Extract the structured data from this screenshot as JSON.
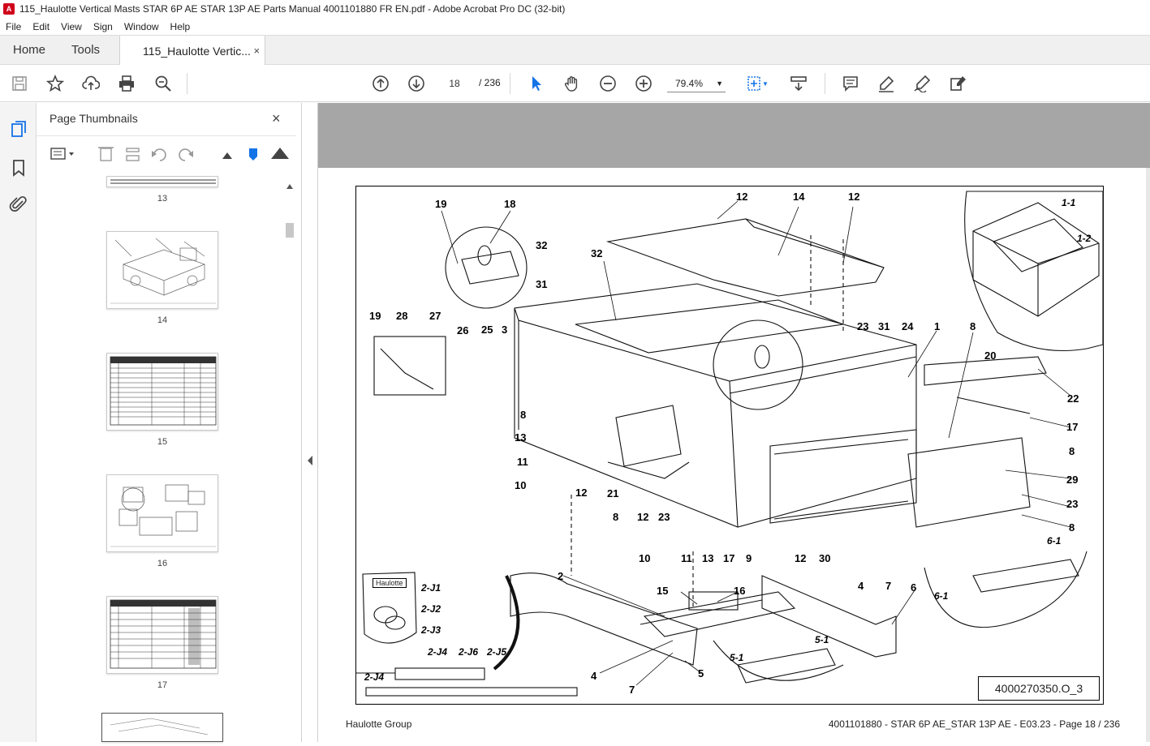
{
  "window": {
    "title": "115_Haulotte Vertical Masts STAR 6P AE STAR 13P AE Parts Manual 4001101880 FR EN.pdf - Adobe Acrobat Pro DC (32-bit)"
  },
  "menu": [
    "File",
    "Edit",
    "View",
    "Sign",
    "Window",
    "Help"
  ],
  "tabs": {
    "home": "Home",
    "tools": "Tools",
    "document": "115_Haulotte Vertic...",
    "close": "×"
  },
  "toolbar": {
    "page_current": "18",
    "page_total": "/ 236",
    "zoom": "79.4%"
  },
  "thumbnails": {
    "title": "Page Thumbnails",
    "close": "×",
    "pages": [
      "13",
      "14",
      "15",
      "16",
      "17"
    ]
  },
  "drawing": {
    "callouts": [
      "19",
      "18",
      "12",
      "14",
      "12",
      "32",
      "32",
      "31",
      "19",
      "28",
      "27",
      "26",
      "25",
      "3",
      "23",
      "31",
      "24",
      "1",
      "8",
      "20",
      "22",
      "8",
      "13",
      "11",
      "10",
      "12",
      "21",
      "8",
      "12",
      "23",
      "10",
      "11",
      "13",
      "17",
      "9",
      "12",
      "30",
      "17",
      "8",
      "29",
      "23",
      "8",
      "2",
      "15",
      "16",
      "4",
      "7",
      "6",
      "4",
      "7",
      "5"
    ],
    "italic_callouts": [
      "1-1",
      "1-2",
      "6-1",
      "6-1",
      "5-1",
      "5-1",
      "2-J1",
      "2-J2",
      "2-J3",
      "2-J4",
      "2-J6",
      "2-J5",
      "2-J4"
    ],
    "kit_label": "Haulotte",
    "reference": "4000270350.O_3"
  },
  "footer": {
    "left": "Haulotte Group",
    "right": "4001101880 - STAR 6P AE_STAR 13P AE - E03.23 - Page 18 / 236"
  }
}
